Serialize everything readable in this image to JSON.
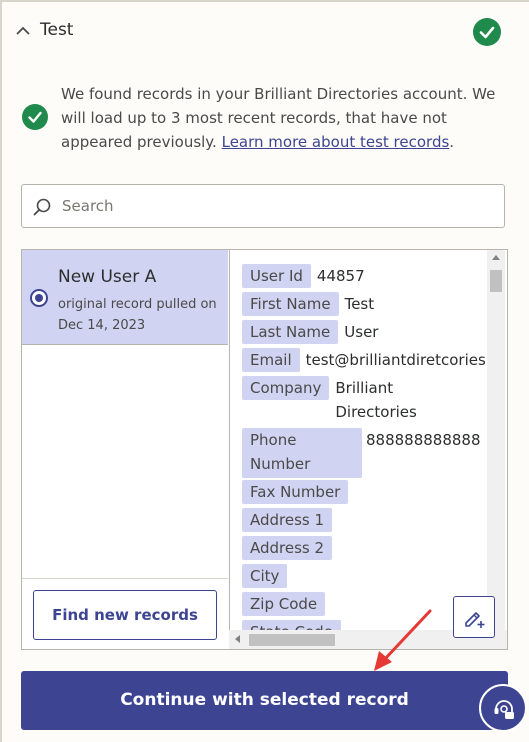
{
  "section": {
    "title": "Test",
    "expanded_icon": "chevron-up-icon",
    "status_icon": "check-circle-icon"
  },
  "info": {
    "text": "We found records in your Brilliant Directories account. We will load up to 3 most recent records, that have not appeared previously.",
    "link": "Learn more about test records",
    "trailing": "."
  },
  "search": {
    "placeholder": "Search"
  },
  "records": [
    {
      "name": "New User A",
      "subtitle": "original record pulled on Dec 14, 2023",
      "selected": true
    }
  ],
  "fields": [
    {
      "key": "User Id",
      "value": "44857"
    },
    {
      "key": "First Name",
      "value": "Test"
    },
    {
      "key": "Last Name",
      "value": "User"
    },
    {
      "key": "Email",
      "value": "test@brilliantdiretcories."
    },
    {
      "key": "Company",
      "value": "Brilliant Directories"
    },
    {
      "key": "Phone Number",
      "value": "888888888888"
    },
    {
      "key": "Fax Number",
      "value": ""
    },
    {
      "key": "Address 1",
      "value": ""
    },
    {
      "key": "Address 2",
      "value": ""
    },
    {
      "key": "City",
      "value": ""
    },
    {
      "key": "Zip Code",
      "value": ""
    },
    {
      "key": "State Code",
      "value": ""
    }
  ],
  "buttons": {
    "find_new": "Find new records",
    "continue": "Continue with selected record"
  },
  "colors": {
    "accent": "#3d4592",
    "highlight": "#d0d3f2",
    "success": "#1f8a4c",
    "annotation": "#e53935"
  }
}
